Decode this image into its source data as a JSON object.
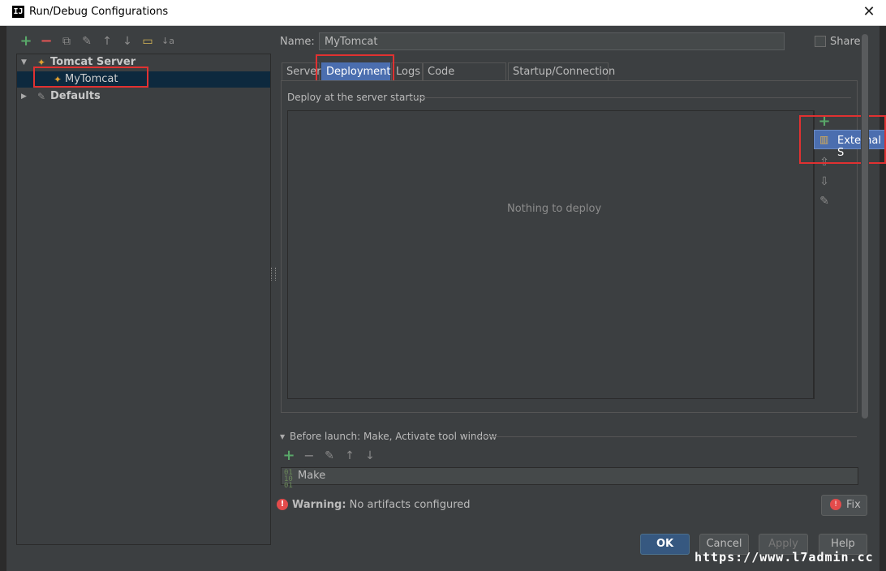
{
  "window": {
    "logo": "IJ",
    "title": "Run/Debug Configurations",
    "close": "✕"
  },
  "toolbar": {
    "add": "+",
    "remove": "−",
    "copy": "⧉",
    "wrench": "✎",
    "up": "↑",
    "down": "↓",
    "folder": "▭",
    "sort": "↓a"
  },
  "tree": {
    "group_label": "Tomcat Server",
    "item_label": "MyTomcat",
    "defaults_label": "Defaults"
  },
  "form": {
    "name_label": "Name:",
    "name_value": "MyTomcat",
    "share_label": "Share"
  },
  "tabs": [
    {
      "label": "Server"
    },
    {
      "label": "Deployment"
    },
    {
      "label": "Logs"
    },
    {
      "label": "Code Coverage"
    },
    {
      "label": "Startup/Connection"
    }
  ],
  "deployment": {
    "section_title": "Deploy at the server startup",
    "empty_text": "Nothing to deploy",
    "add": "+",
    "popup_label": "External S",
    "up": "⇧",
    "down": "⇩",
    "edit": "✎"
  },
  "before_launch": {
    "label": "Before launch: Make, Activate tool window",
    "add": "+",
    "remove": "−",
    "edit": "✎",
    "up": "↑",
    "down": "↓",
    "make_label": "Make"
  },
  "warning": {
    "icon": "!",
    "bold": "Warning:",
    "text": "No artifacts configured",
    "fix_label": "Fix"
  },
  "buttons": {
    "ok": "OK",
    "cancel": "Cancel",
    "apply": "Apply",
    "help": "Help"
  },
  "watermark": "https://www.l7admin.cc",
  "colors": {
    "accent": "#4b6eaf",
    "highlight": "#e03131",
    "background": "#3c3f41"
  }
}
